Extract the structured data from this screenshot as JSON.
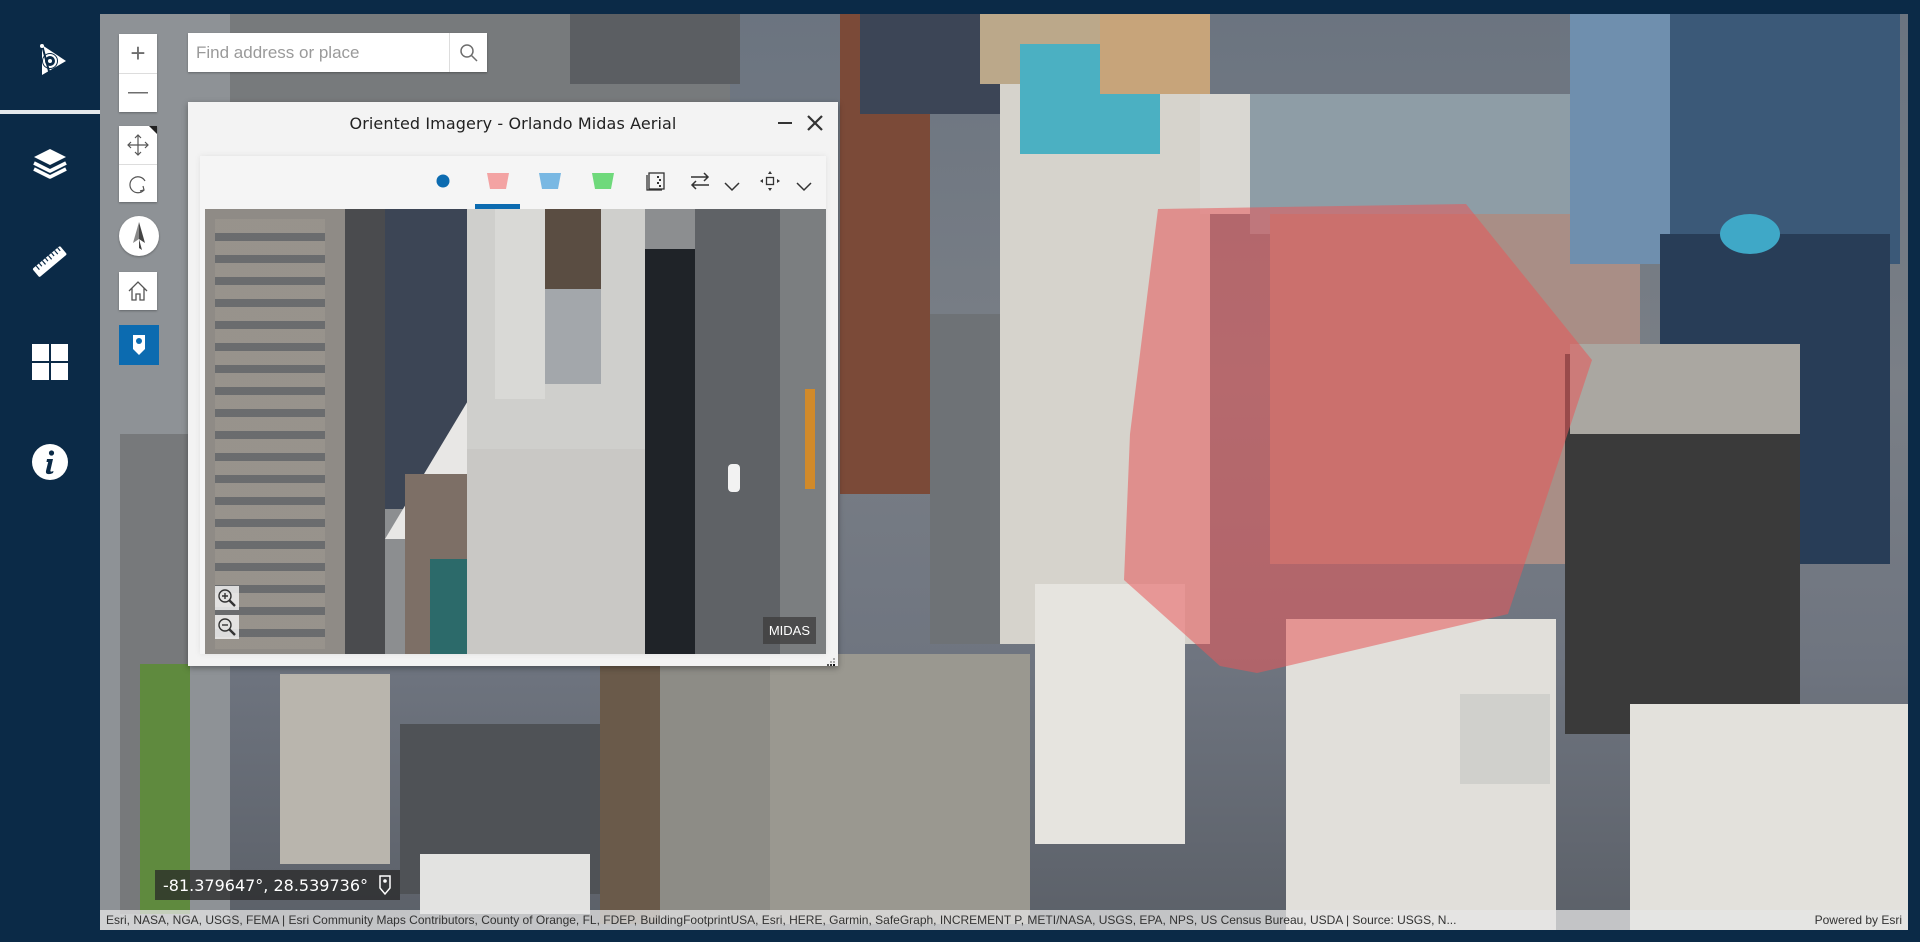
{
  "sidebar": {
    "items": [
      {
        "name": "oriented-imagery",
        "icon": "oriented-imagery-icon"
      },
      {
        "name": "layers",
        "icon": "layers-icon"
      },
      {
        "name": "measure",
        "icon": "ruler-icon"
      },
      {
        "name": "basemap-gallery",
        "icon": "grid-icon"
      },
      {
        "name": "about",
        "icon": "info-icon"
      }
    ],
    "active_index": 0
  },
  "map": {
    "zoom_in_label": "+",
    "zoom_out_label": "—",
    "search": {
      "placeholder": "Find address or place",
      "value": ""
    },
    "navigation": {
      "pan": "pan-icon",
      "rotate": "rotate-icon",
      "compass": "compass-icon",
      "home": "home-icon",
      "oriented_imagery": "map-pin-icon"
    },
    "coordinates": "-81.379647°, 28.539736°",
    "attribution": "Esri, NASA, NGA, USGS, FEMA | Esri Community Maps Contributors, County of Orange, FL, FDEP, BuildingFootprintUSA, Esri, HERE, Garmin, SafeGraph, INCREMENT P, METI/NASA, USGS, EPA, NPS, US Census Bureau, USDA | Source: USGS, N...",
    "powered_by": "Powered by Esri",
    "footprint_color": "#e8585a"
  },
  "panel": {
    "title": "Oriented Imagery - Orlando Midas Aerial",
    "minimize_label": "—",
    "close_label": "✕",
    "toolbar": [
      {
        "name": "camera-location",
        "icon": "dot-icon",
        "color": "#0c6bb0"
      },
      {
        "name": "footprint-red",
        "icon": "trapezoid-icon",
        "color": "#f3a3a3",
        "active": true
      },
      {
        "name": "footprint-blue",
        "icon": "trapezoid-icon",
        "color": "#79b8e3"
      },
      {
        "name": "footprint-green",
        "icon": "trapezoid-icon",
        "color": "#6fd97b"
      },
      {
        "name": "image-gallery",
        "icon": "gallery-icon"
      },
      {
        "name": "swap-direction",
        "icon": "swap-arrows-icon"
      },
      {
        "name": "swap-menu",
        "icon": "chevron-down-icon"
      },
      {
        "name": "navigate",
        "icon": "move-arrows-icon"
      },
      {
        "name": "navigate-menu",
        "icon": "chevron-down-icon"
      }
    ],
    "viewer": {
      "zoom_in": "zoom-in-icon",
      "zoom_out": "zoom-out-icon",
      "watermark": "MIDAS"
    }
  }
}
